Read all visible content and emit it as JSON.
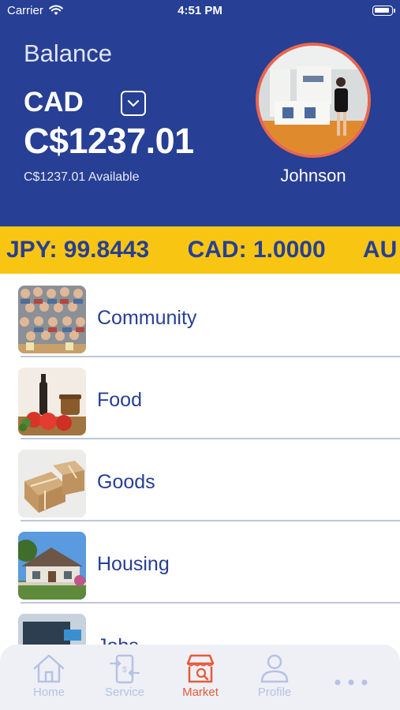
{
  "status_bar": {
    "carrier": "Carrier",
    "time": "4:51 PM"
  },
  "balance": {
    "label": "Balance",
    "currency": "CAD",
    "amount": "C$1237.01",
    "available": "C$1237.01 Available"
  },
  "profile": {
    "name": "Johnson"
  },
  "ticker": {
    "items": [
      "JPY: 99.8443",
      "CAD: 1.0000",
      "AU"
    ]
  },
  "categories": [
    {
      "label": "Community"
    },
    {
      "label": "Food"
    },
    {
      "label": "Goods"
    },
    {
      "label": "Housing"
    },
    {
      "label": "Jobs"
    }
  ],
  "tabbar": {
    "items": [
      {
        "label": "Home",
        "icon": "home-icon"
      },
      {
        "label": "Service",
        "icon": "service-icon"
      },
      {
        "label": "Market",
        "icon": "market-icon",
        "active": true
      },
      {
        "label": "Profile",
        "icon": "profile-icon"
      },
      {
        "label": "",
        "icon": "more-icon"
      }
    ]
  },
  "colors": {
    "primary": "#273f94",
    "accent": "#f8c612",
    "active_tab": "#e65a3b",
    "inactive_tab": "#b6c2e4"
  }
}
